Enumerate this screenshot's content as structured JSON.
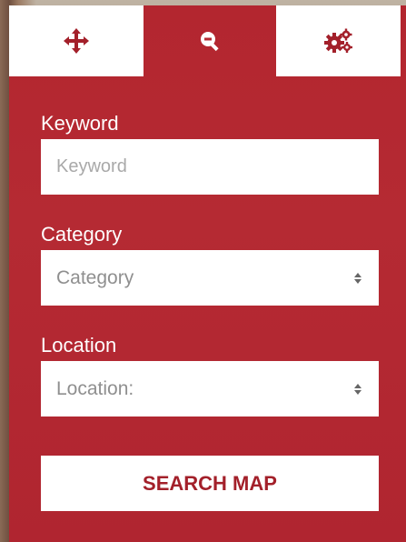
{
  "tabs": [
    {
      "icon": "move-arrows-icon"
    },
    {
      "icon": "zoom-out-icon"
    },
    {
      "icon": "gears-icon"
    }
  ],
  "form": {
    "keyword": {
      "label": "Keyword",
      "placeholder": "Keyword"
    },
    "category": {
      "label": "Category",
      "selected": "Category"
    },
    "location": {
      "label": "Location",
      "selected": "Location:"
    },
    "submit_label": "SEARCH MAP"
  },
  "colors": {
    "accent": "#b52a33",
    "button_text": "#a3202a",
    "tab_icon": "#a3202a"
  }
}
